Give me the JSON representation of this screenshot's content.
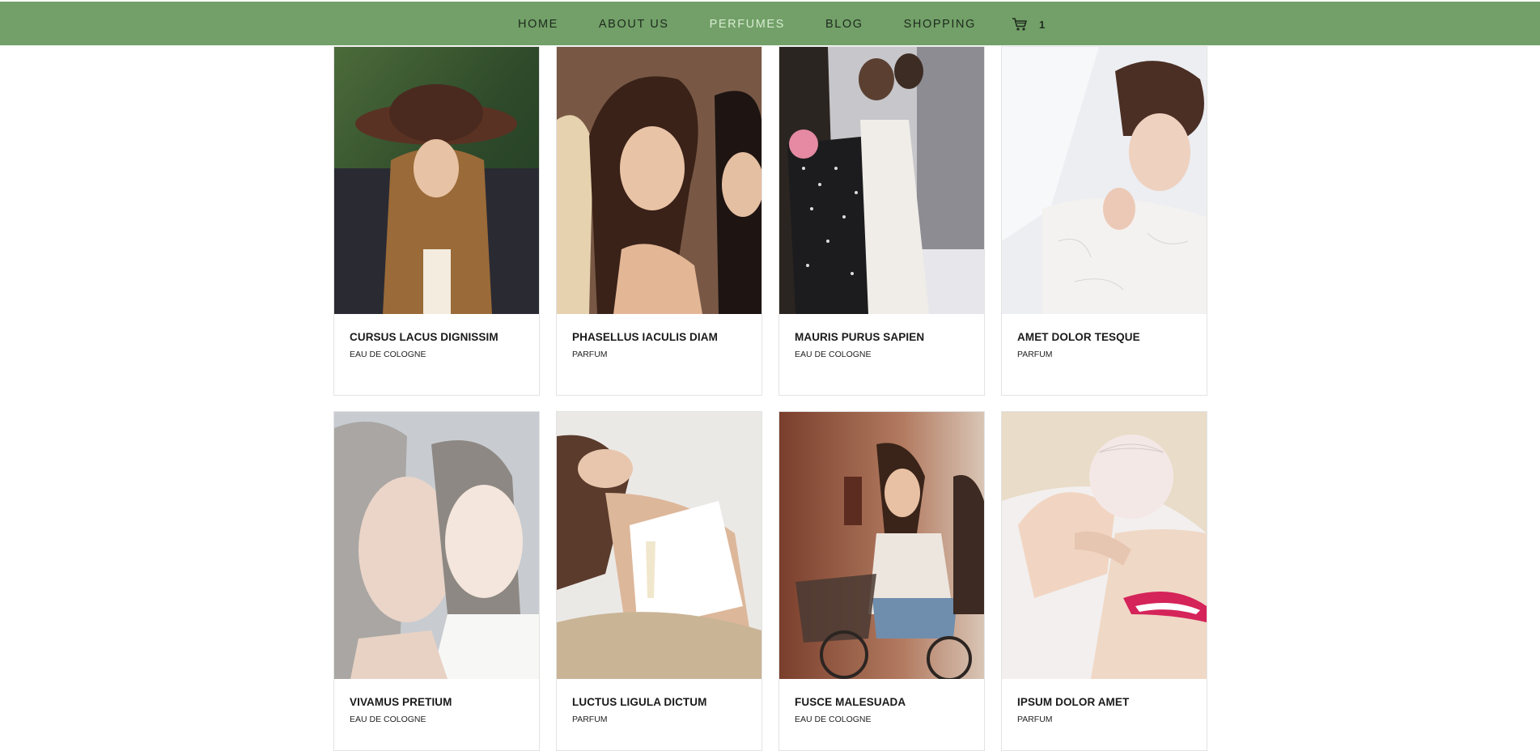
{
  "nav": {
    "items": [
      {
        "label": "HOME",
        "active": false
      },
      {
        "label": "ABOUT US",
        "active": false
      },
      {
        "label": "PERFUMES",
        "active": true
      },
      {
        "label": "BLOG",
        "active": false
      },
      {
        "label": "SHOPPING",
        "active": false
      }
    ],
    "cart_icon": "shopping-cart-icon",
    "cart_count": "1"
  },
  "colors": {
    "nav_background": "#72a068",
    "nav_active": "#d6ecd0",
    "card_border": "#e3e3e3"
  },
  "products": [
    {
      "title": "CURSUS LACUS DIGNISSIM",
      "type": "EAU DE COLOGNE"
    },
    {
      "title": "PHASELLUS IACULIS DIAM",
      "type": "PARFUM"
    },
    {
      "title": "MAURIS PURUS SAPIEN",
      "type": "EAU DE COLOGNE"
    },
    {
      "title": "AMET DOLOR TESQUE",
      "type": "PARFUM"
    },
    {
      "title": "VIVAMUS PRETIUM",
      "type": "EAU DE COLOGNE"
    },
    {
      "title": "LUCTUS LIGULA DICTUM",
      "type": "PARFUM"
    },
    {
      "title": "FUSCE MALESUADA",
      "type": "EAU DE COLOGNE"
    },
    {
      "title": "IPSUM DOLOR AMET",
      "type": "PARFUM"
    }
  ]
}
